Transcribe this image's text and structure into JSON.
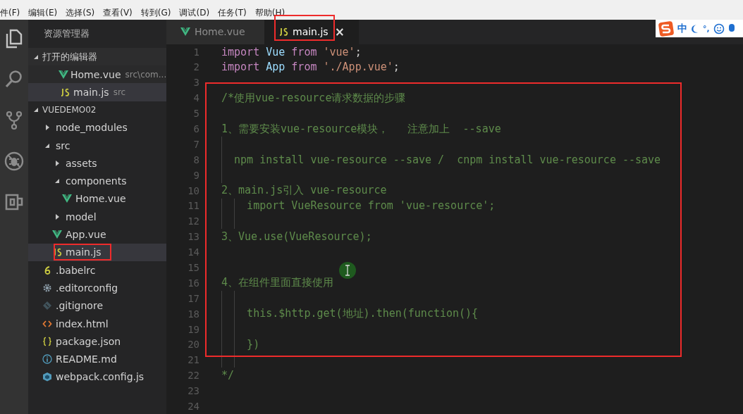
{
  "menu": [
    "件(F)",
    "编辑(E)",
    "选择(S)",
    "查看(V)",
    "转到(G)",
    "调试(D)",
    "任务(T)",
    "帮助(H)"
  ],
  "sidebar": {
    "title": "资源管理器",
    "open_editors": {
      "title": "打开的编辑器",
      "expanded": true,
      "items": [
        {
          "name": "Home.vue",
          "path": "src\\com...",
          "kind": "vue",
          "selected": false
        },
        {
          "name": "main.js",
          "path": "src",
          "kind": "js",
          "selected": true
        }
      ]
    },
    "project": {
      "title": "VUEDEMO02",
      "expanded": true,
      "items": [
        {
          "name": "node_modules",
          "kind": "folder",
          "expanded": false,
          "selected": false,
          "annotated": false
        },
        {
          "name": "src",
          "kind": "folder",
          "expanded": true,
          "selected": false,
          "annotated": false,
          "children": [
            {
              "name": "assets",
              "kind": "folder",
              "expanded": false,
              "selected": false,
              "annotated": false
            },
            {
              "name": "components",
              "kind": "folder",
              "expanded": true,
              "selected": false,
              "annotated": false,
              "children": [
                {
                  "name": "Home.vue",
                  "kind": "vue",
                  "selected": false,
                  "annotated": false
                }
              ]
            },
            {
              "name": "model",
              "kind": "folder",
              "expanded": false,
              "selected": false,
              "annotated": false
            },
            {
              "name": "App.vue",
              "kind": "vue",
              "selected": false,
              "annotated": false
            },
            {
              "name": "main.js",
              "kind": "js",
              "selected": true,
              "annotated": true
            }
          ]
        },
        {
          "name": ".babelrc",
          "kind": "babel",
          "selected": false,
          "annotated": false
        },
        {
          "name": ".editorconfig",
          "kind": "config",
          "selected": false,
          "annotated": false
        },
        {
          "name": ".gitignore",
          "kind": "git",
          "selected": false,
          "annotated": false
        },
        {
          "name": "index.html",
          "kind": "html",
          "selected": false,
          "annotated": false
        },
        {
          "name": "package.json",
          "kind": "json",
          "selected": false,
          "annotated": false
        },
        {
          "name": "README.md",
          "kind": "info",
          "selected": false,
          "annotated": false
        },
        {
          "name": "webpack.config.js",
          "kind": "webpack",
          "selected": false,
          "annotated": false
        }
      ]
    }
  },
  "tabs": [
    {
      "label": "Home.vue",
      "kind": "vue",
      "selected": false,
      "annotated": false
    },
    {
      "label": "main.js",
      "kind": "js",
      "selected": true,
      "annotated": true,
      "close": "×"
    }
  ],
  "ime": {
    "mode": "中",
    "punct": "°,"
  },
  "code": {
    "blocks": [
      {
        "boxed": false,
        "lines": [
          {
            "number": "1",
            "tokens": [
              {
                "kind": "keyword",
                "text": "import "
              },
              {
                "kind": "ident",
                "text": "Vue "
              },
              {
                "kind": "keyword",
                "text": "from "
              },
              {
                "kind": "string",
                "text": "'vue'"
              },
              {
                "kind": "plain",
                "text": ";"
              }
            ]
          },
          {
            "number": "2",
            "tokens": [
              {
                "kind": "keyword",
                "text": "import "
              },
              {
                "kind": "ident",
                "text": "App "
              },
              {
                "kind": "keyword",
                "text": "from "
              },
              {
                "kind": "string",
                "text": "'./App.vue'"
              },
              {
                "kind": "plain",
                "text": ";"
              }
            ]
          },
          {
            "number": "3"
          }
        ]
      },
      {
        "boxed": true,
        "lines": [
          {
            "number": "4",
            "tokens": [
              {
                "kind": "comment",
                "text": "/*使用vue-resource请求数据的步骤"
              }
            ]
          },
          {
            "number": "5"
          },
          {
            "number": "6",
            "tokens": [
              {
                "kind": "comment",
                "text": "1、需要安装vue-resource模块，   注意加上  --save"
              }
            ]
          },
          {
            "number": "7"
          },
          {
            "number": "8",
            "tokens": [
              {
                "kind": "comment",
                "text": "  npm install vue-resource --save /  cnpm install vue-resource --save"
              }
            ]
          },
          {
            "number": "9"
          },
          {
            "number": "10",
            "tokens": [
              {
                "kind": "comment",
                "text": "2、main.js引入 vue-resource"
              }
            ]
          },
          {
            "number": "11",
            "tokens": [
              {
                "kind": "comment",
                "text": "    import VueResource from 'vue-resource';"
              }
            ]
          },
          {
            "number": "12"
          },
          {
            "number": "13",
            "tokens": [
              {
                "kind": "comment",
                "text": "3、Vue.use(VueResource);"
              }
            ]
          },
          {
            "number": "14"
          },
          {
            "number": "15"
          },
          {
            "number": "16",
            "tokens": [
              {
                "kind": "comment",
                "text": "4、在组件里面直接使用"
              }
            ]
          },
          {
            "number": "17"
          },
          {
            "number": "18",
            "tokens": [
              {
                "kind": "comment",
                "text": "    this.$http.get(地址).then(function(){"
              }
            ]
          },
          {
            "number": "19"
          },
          {
            "number": "20",
            "tokens": [
              {
                "kind": "comment",
                "text": "    })"
              }
            ]
          }
        ]
      },
      {
        "boxed": false,
        "lines": [
          {
            "number": "21"
          },
          {
            "number": "22",
            "tokens": [
              {
                "kind": "comment",
                "text": "*/"
              }
            ]
          },
          {
            "number": "23"
          },
          {
            "number": "24"
          }
        ]
      }
    ]
  }
}
